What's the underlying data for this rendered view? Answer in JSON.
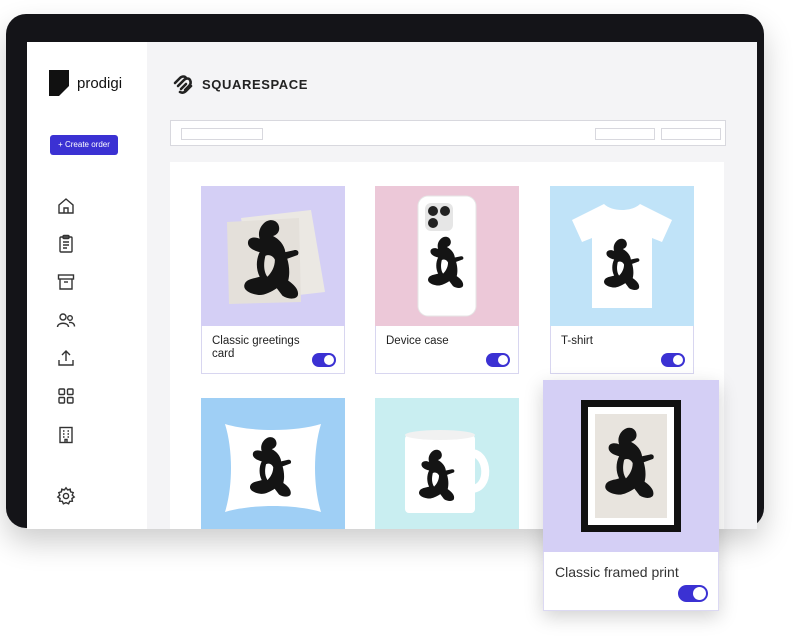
{
  "app": {
    "name": "prodigi"
  },
  "sidebar": {
    "create_order_label": "+ Create order",
    "items": [
      {
        "icon": "home-icon"
      },
      {
        "icon": "clipboard-icon"
      },
      {
        "icon": "archive-icon"
      },
      {
        "icon": "users-icon"
      },
      {
        "icon": "upload-icon"
      },
      {
        "icon": "grid-icon"
      },
      {
        "icon": "building-icon"
      },
      {
        "icon": "gear-icon"
      }
    ]
  },
  "header": {
    "brand": "SQUARESPACE"
  },
  "products": [
    {
      "label": "Classic greetings card",
      "bg": "#d4cff5",
      "enabled": true
    },
    {
      "label": "Device case",
      "bg": "#ecc8d8",
      "enabled": true
    },
    {
      "label": "T-shirt",
      "bg": "#c0e3f8",
      "enabled": true
    },
    {
      "label": "",
      "bg": "#9fcff5",
      "enabled": true
    },
    {
      "label": "",
      "bg": "#c9eef1",
      "enabled": true
    }
  ],
  "featured": {
    "label": "Classic framed print",
    "bg": "#d4cff5",
    "enabled": true
  },
  "colors": {
    "accent": "#3b31d3"
  }
}
